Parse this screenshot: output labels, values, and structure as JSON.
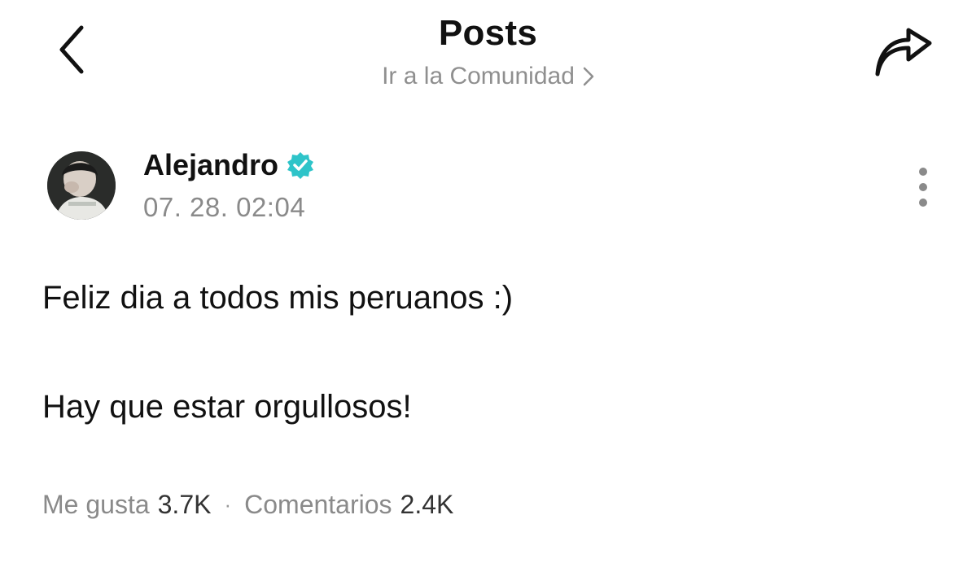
{
  "header": {
    "title": "Posts",
    "community_link": "Ir a la Comunidad"
  },
  "post": {
    "author": "Alejandro",
    "timestamp": "07. 28. 02:04",
    "lines": [
      "Feliz dia a todos mis peruanos :)",
      "Hay que estar orgullosos!"
    ],
    "likes_label": "Me gusta",
    "likes_count": "3.7K",
    "separator": "·",
    "comments_label": "Comentarios",
    "comments_count": "2.4K"
  },
  "icons": {
    "back": "chevron-left-icon",
    "share": "share-arrow-icon",
    "verified": "verified-badge-icon",
    "more": "more-vertical-icon"
  },
  "colors": {
    "verified": "#2ec4c9",
    "muted_text": "#8a8a8a"
  }
}
